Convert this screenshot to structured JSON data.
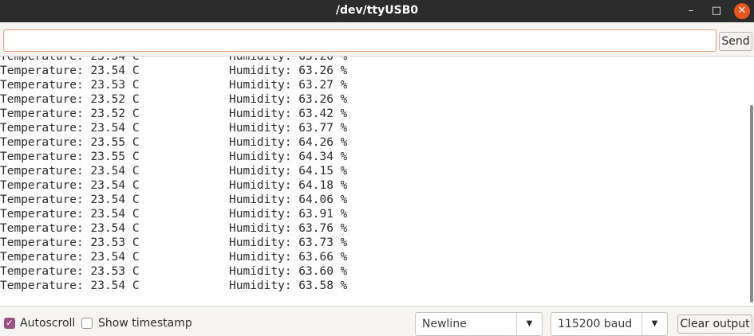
{
  "window": {
    "title": "/dev/ttyUSB0",
    "minimize_glyph": "–",
    "maximize_glyph": "□",
    "close_glyph": "✕"
  },
  "send": {
    "input_value": "",
    "button_label": "Send"
  },
  "output": {
    "lines": [
      {
        "temperature": "Temperature: 23.54 C",
        "humidity": "Humidity: 63.26 %"
      },
      {
        "temperature": "Temperature: 23.53 C",
        "humidity": "Humidity: 63.27 %"
      },
      {
        "temperature": "Temperature: 23.52 C",
        "humidity": "Humidity: 63.26 %"
      },
      {
        "temperature": "Temperature: 23.52 C",
        "humidity": "Humidity: 63.42 %"
      },
      {
        "temperature": "Temperature: 23.54 C",
        "humidity": "Humidity: 63.77 %"
      },
      {
        "temperature": "Temperature: 23.55 C",
        "humidity": "Humidity: 64.26 %"
      },
      {
        "temperature": "Temperature: 23.55 C",
        "humidity": "Humidity: 64.34 %"
      },
      {
        "temperature": "Temperature: 23.54 C",
        "humidity": "Humidity: 64.15 %"
      },
      {
        "temperature": "Temperature: 23.54 C",
        "humidity": "Humidity: 64.18 %"
      },
      {
        "temperature": "Temperature: 23.54 C",
        "humidity": "Humidity: 64.06 %"
      },
      {
        "temperature": "Temperature: 23.54 C",
        "humidity": "Humidity: 63.91 %"
      },
      {
        "temperature": "Temperature: 23.54 C",
        "humidity": "Humidity: 63.76 %"
      },
      {
        "temperature": "Temperature: 23.53 C",
        "humidity": "Humidity: 63.73 %"
      },
      {
        "temperature": "Temperature: 23.54 C",
        "humidity": "Humidity: 63.66 %"
      },
      {
        "temperature": "Temperature: 23.53 C",
        "humidity": "Humidity: 63.60 %"
      },
      {
        "temperature": "Temperature: 23.54 C",
        "humidity": "Humidity: 63.58 %"
      }
    ]
  },
  "footer": {
    "autoscroll_label": "Autoscroll",
    "autoscroll_checked": true,
    "timestamp_label": "Show timestamp",
    "timestamp_checked": false,
    "line_ending": "Newline",
    "baud_rate": "115200 baud",
    "clear_label": "Clear output"
  },
  "colors": {
    "titlebar": "#2c2c2c",
    "close_button": "#e95420",
    "checkbox_accent": "#9c5385",
    "input_focus_border": "#e9a07c"
  }
}
